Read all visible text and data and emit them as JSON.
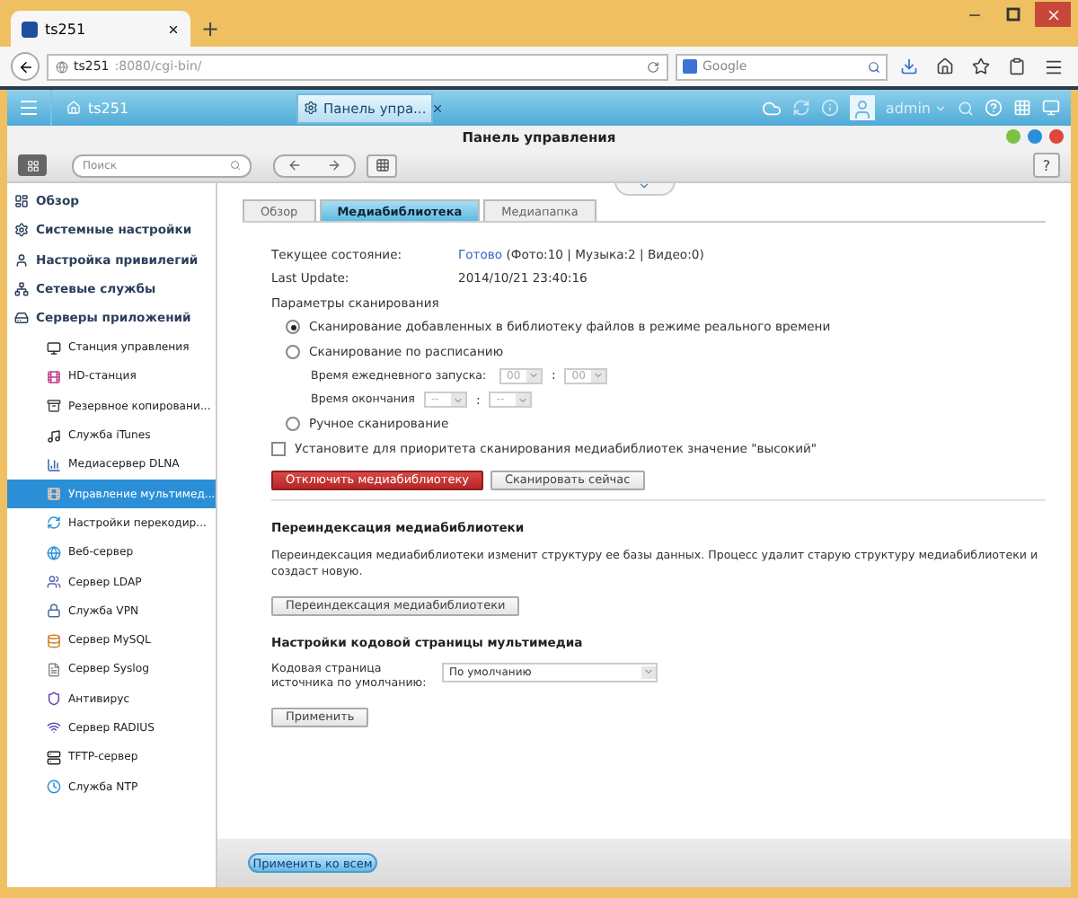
{
  "browser": {
    "tab_title": "ts251",
    "new_tab": "+",
    "address": {
      "host": "ts251",
      "path": ":8080/cgi-bin/"
    },
    "search_placeholder": "Google"
  },
  "topbar": {
    "home": "ts251",
    "app_tab": "Панель упра...",
    "user": "admin"
  },
  "window": {
    "title": "Панель управления",
    "search_placeholder": "Поиск",
    "help": "?"
  },
  "sidebar": {
    "items": [
      {
        "label": "Обзор",
        "kind": "grid",
        "selected": false
      },
      {
        "label": "Системные настройки",
        "kind": "gear",
        "selected": false
      },
      {
        "label": "Настройка привилегий",
        "kind": "user",
        "selected": false
      },
      {
        "label": "Сетевые службы",
        "kind": "network",
        "selected": false
      },
      {
        "label": "Серверы приложений",
        "kind": "server",
        "selected": false,
        "children": [
          {
            "label": "Станция управления",
            "kind": "monitor",
            "selected": false
          },
          {
            "label": "HD-станция",
            "kind": "hd",
            "selected": false
          },
          {
            "label": "Резервное копировани...",
            "kind": "backup",
            "selected": false
          },
          {
            "label": "Служба iTunes",
            "kind": "music",
            "selected": false
          },
          {
            "label": "Медиасервер DLNA",
            "kind": "chart",
            "selected": false
          },
          {
            "label": "Управление мультимед...",
            "kind": "media",
            "selected": true
          },
          {
            "label": "Настройки перекодир...",
            "kind": "refresh",
            "selected": false
          },
          {
            "label": "Веб-сервер",
            "kind": "globe",
            "selected": false
          },
          {
            "label": "Сервер LDAP",
            "kind": "users",
            "selected": false
          },
          {
            "label": "Служба VPN",
            "kind": "vpn",
            "selected": false
          },
          {
            "label": "Сервер MySQL",
            "kind": "db",
            "selected": false
          },
          {
            "label": "Сервер Syslog",
            "kind": "log",
            "selected": false
          },
          {
            "label": "Антивирус",
            "kind": "shield",
            "selected": false
          },
          {
            "label": "Сервер RADIUS",
            "kind": "radius",
            "selected": false
          },
          {
            "label": "TFTP-сервер",
            "kind": "tftp",
            "selected": false
          },
          {
            "label": "Служба NTP",
            "kind": "clock",
            "selected": false
          }
        ]
      }
    ]
  },
  "tabs": [
    {
      "label": "Обзор",
      "selected": false
    },
    {
      "label": "Медиабиблиотека",
      "selected": true
    },
    {
      "label": "Медиапапка",
      "selected": false
    }
  ],
  "status": {
    "label": "Текущее состояние:",
    "state": "Готово",
    "counts": "(Фото:10  |  Музыка:2  |  Видео:0)"
  },
  "last_update": {
    "label": "Last Update:",
    "value": "2014/10/21 23:40:16"
  },
  "scan": {
    "heading": "Параметры сканирования",
    "options": [
      {
        "label": "Сканирование добавленных в библиотеку файлов в режиме реального времени",
        "selected": true
      },
      {
        "label": "Сканирование по расписанию",
        "selected": false
      },
      {
        "label": "Ручное сканирование",
        "selected": false
      }
    ],
    "start": {
      "label": "Время ежедневного запуска:",
      "hour": "00",
      "minute": "00",
      "separator": ":"
    },
    "end": {
      "label": "Время окончания",
      "hour": "--",
      "minute": "--",
      "separator": ":"
    },
    "schedule_disabled": true,
    "priority": {
      "label": "Установите для приоритета сканирования медиабиблиотек значение \"высокий\"",
      "checked": false
    },
    "buttons": [
      {
        "label": "Отключить медиабиблиотеку",
        "kind": "danger"
      },
      {
        "label": "Сканировать сейчас",
        "kind": "normal"
      }
    ]
  },
  "reindex": {
    "heading": "Переиндексация медиабиблиотеки",
    "text": "Переиндексация медиабиблиотеки изменит структуру ее базы данных. Процесс удалит старую структуру медиабиблиотеки и создаст новую.",
    "button": "Переиндексация медиабиблиотеки"
  },
  "codepage": {
    "heading": "Настройки кодовой страницы мультимедиа",
    "label": "Кодовая страница источника по умолчанию:",
    "value": "По умолчанию",
    "button": "Применить"
  },
  "footer": {
    "button": "Применить ко всем"
  }
}
